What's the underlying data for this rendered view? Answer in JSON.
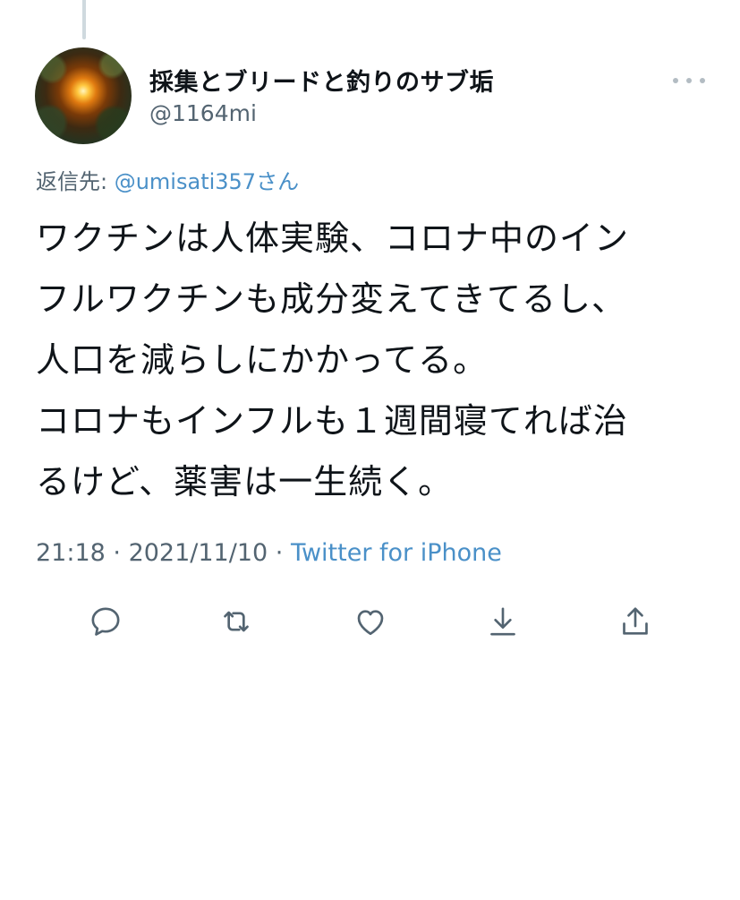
{
  "tweet": {
    "display_name": "採集とブリードと釣りのサブ垢",
    "handle": "@1164mi",
    "reply_prefix": "返信先: ",
    "reply_mention": "@umisati357",
    "reply_suffix": "さん",
    "text": "ワクチンは人体実験、コロナ中のイン\nフルワクチンも成分変えてきてるし、\n人口を減らしにかかってる。\nコロナもインフルも１週間寝てれば治\nるけど、薬害は一生続く。",
    "time": "21:18",
    "date": "2021/11/10",
    "separator": " · ",
    "source": "Twitter for iPhone"
  },
  "actions": {
    "reply_icon": "reply-icon",
    "retweet_icon": "retweet-icon",
    "like_icon": "heart-icon",
    "save_icon": "download-icon",
    "share_icon": "share-icon"
  },
  "colors": {
    "link": "#4a90c8",
    "secondary_text": "#536471",
    "icon": "#536471"
  }
}
